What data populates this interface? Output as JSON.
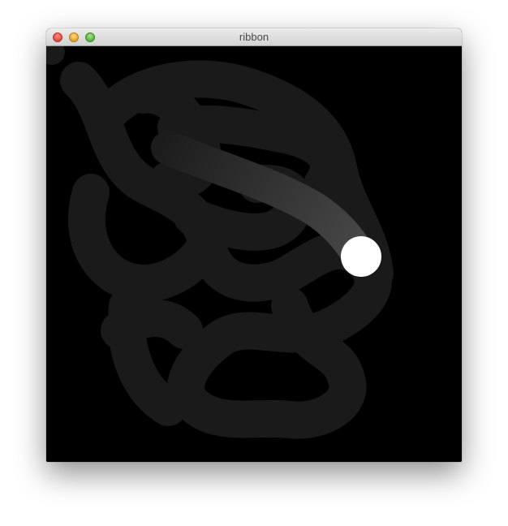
{
  "window": {
    "title": "ribbon",
    "buttons": {
      "close": "close-button",
      "minimize": "minimize-button",
      "maximize": "zoom-button"
    }
  },
  "canvas": {
    "background": "#000000",
    "trail_color": "#1a1a1a",
    "ribbon_color": "#3a3a3a",
    "ball_color": "#ffffff"
  }
}
